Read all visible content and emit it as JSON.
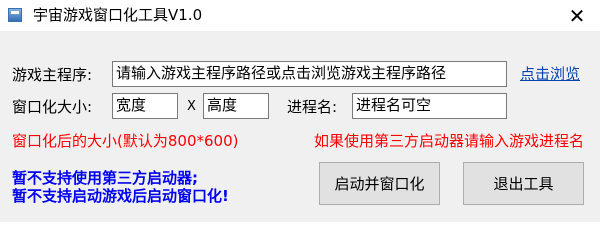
{
  "window": {
    "title": "宇宙游戏窗口化工具V1.0",
    "close_glyph": "✕"
  },
  "form": {
    "game_main_label": "游戏主程序:",
    "game_main_value": "请输入游戏主程序路径或点击浏览游戏主程序路径",
    "browse_link": "点击浏览",
    "window_size_label": "窗口化大小:",
    "width_value": "宽度",
    "x_separator": "X",
    "height_value": "高度",
    "process_label": "进程名:",
    "process_value": "进程名可空",
    "size_hint": "窗口化后的大小(默认为800*600)",
    "launcher_hint": "如果使用第三方启动器请输入游戏进程名"
  },
  "notice": {
    "line1": "暂不支持使用第三方启动器;",
    "line2": "暂不支持启动游戏后启动窗口化!"
  },
  "buttons": {
    "start_label": "启动并窗口化",
    "exit_label": "退出工具"
  },
  "colors": {
    "hint_red": "#ff0000",
    "notice_blue": "#0000ee",
    "link_blue": "#0645ad"
  }
}
